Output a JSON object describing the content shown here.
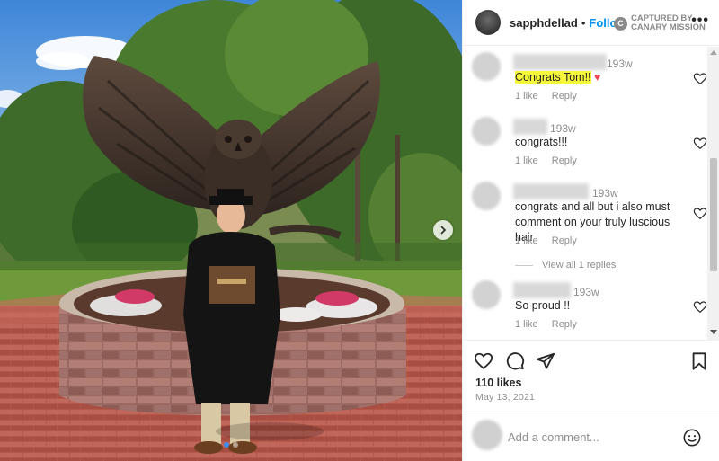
{
  "post": {
    "photo_alt": "Graduate in cap and gown holding diploma in front of a bronze owl statue",
    "carousel": {
      "total": 2,
      "active": 1
    }
  },
  "header": {
    "username": "sapphdellad",
    "separator": "•",
    "follow_label": "Follow",
    "more_label": "•••"
  },
  "watermark": {
    "icon": "C",
    "line1": "CAPTURED BY",
    "line2": "CANARY MISSION"
  },
  "comments": [
    {
      "time": "193w",
      "text": "Congrats Tom!!",
      "emoji": "♥",
      "likes": "1 like",
      "reply": "Reply",
      "highlight": true
    },
    {
      "time": "193w",
      "text": "congrats!!!",
      "likes": "1 like",
      "reply": "Reply"
    },
    {
      "time": "193w",
      "text": "congrats and all but i also must comment on your truly luscious hair",
      "likes": "1 like",
      "reply": "Reply",
      "view_replies": "View all 1 replies"
    },
    {
      "time": "193w",
      "text": "So proud !!",
      "likes": "1 like",
      "reply": "Reply"
    }
  ],
  "actions": {
    "icons": [
      "heart-icon",
      "comment-icon",
      "share-icon",
      "bookmark-icon"
    ]
  },
  "likes": "110 likes",
  "date": "May 13, 2021",
  "add_comment": {
    "placeholder": "Add a comment..."
  },
  "colors": {
    "follow": "#0095f6",
    "highlight": "#f7f73a",
    "heart": "#ed4956",
    "muted": "#8e8e8e"
  }
}
